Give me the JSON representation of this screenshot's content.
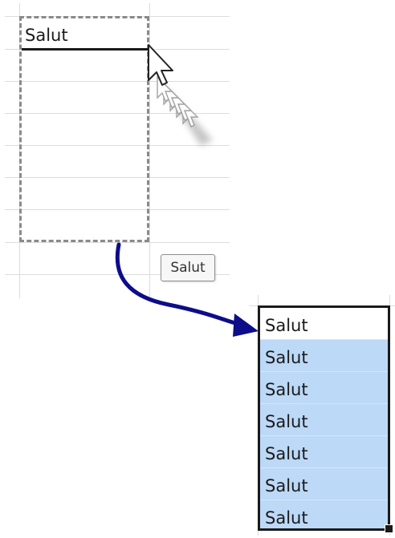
{
  "source_range": {
    "cell_value": "Salut"
  },
  "drag_tooltip": {
    "text": "Salut"
  },
  "result_range": {
    "cells": [
      "Salut",
      "Salut",
      "Salut",
      "Salut",
      "Salut",
      "Salut",
      "Salut"
    ]
  },
  "colors": {
    "selection_highlight": "#bcd9f7",
    "arrow": "#0d0d8a",
    "grid_line": "#dcdcdc",
    "border": "#1a1a1a"
  }
}
